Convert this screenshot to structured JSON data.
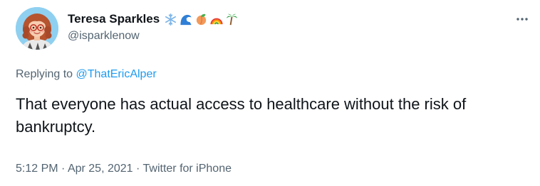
{
  "author": {
    "display_name": "Teresa Sparkles",
    "handle": "@isparklenow",
    "name_emojis": [
      "snowflake-emoji",
      "wave-emoji",
      "peach-emoji",
      "rainbow-emoji",
      "palm-tree-emoji"
    ]
  },
  "reply": {
    "prefix": "Replying to ",
    "mention": "@ThatEricAlper"
  },
  "tweet": {
    "text": "That everyone has actual access to healthcare without the risk of bankruptcy."
  },
  "meta": {
    "time": "5:12 PM",
    "separator1": " · ",
    "date": "Apr 25, 2021",
    "separator2": " · ",
    "source": "Twitter for iPhone"
  },
  "colors": {
    "text_primary": "#0f1419",
    "text_secondary": "#536471",
    "link_blue": "#1d9bf0",
    "avatar_bg": "#8fd0f0"
  },
  "icons": {
    "more": "more-horizontal-icon"
  }
}
